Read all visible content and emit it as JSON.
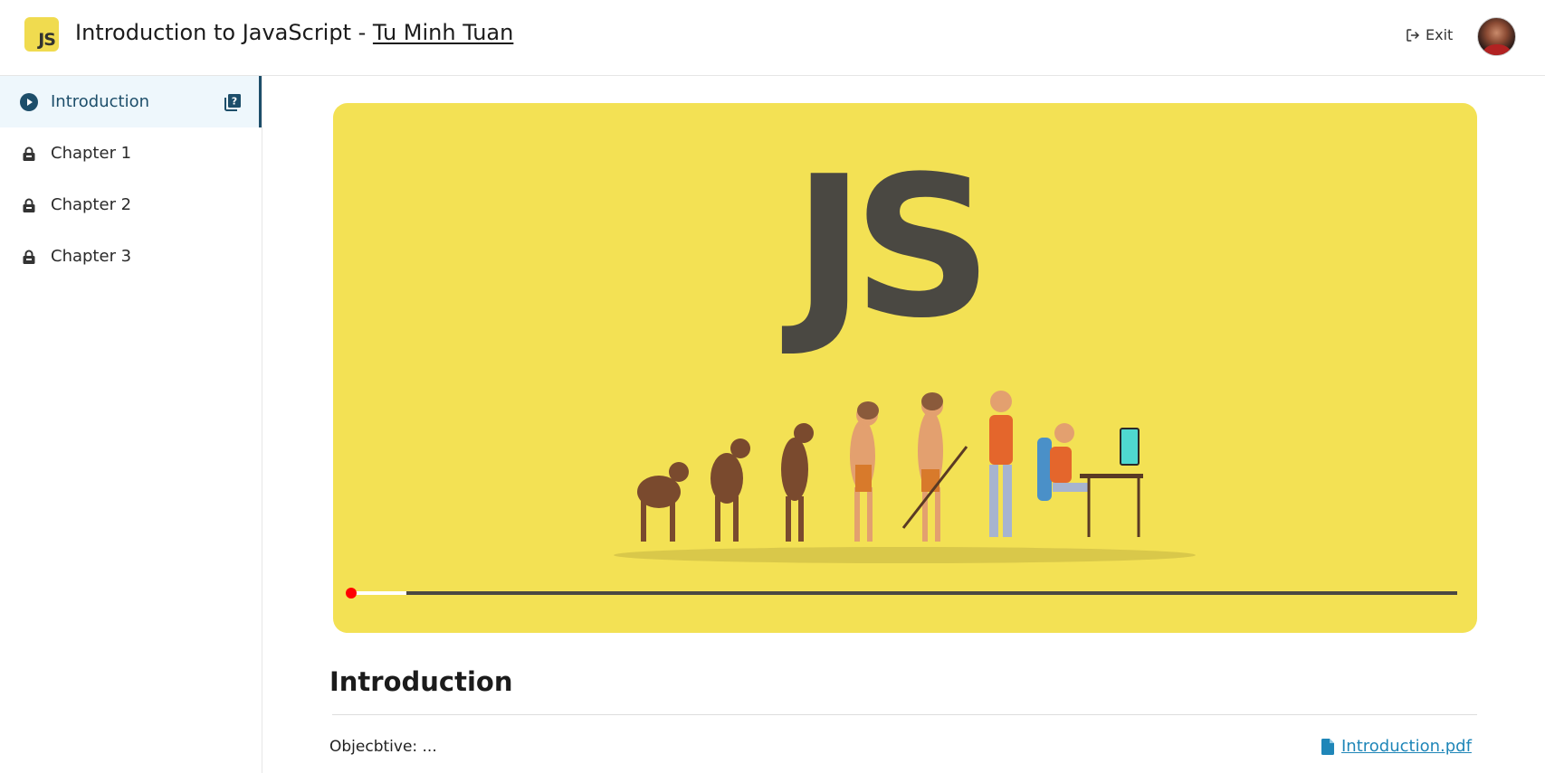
{
  "header": {
    "logo_text": "JS",
    "course_title": "Introduction to JavaScript - ",
    "author": "Tu Minh Tuan",
    "exit_label": "Exit"
  },
  "sidebar": {
    "items": [
      {
        "label": "Introduction",
        "icon": "play-circle-icon",
        "active": true,
        "locked": false
      },
      {
        "label": "Chapter 1",
        "icon": "lock-icon",
        "active": false,
        "locked": true
      },
      {
        "label": "Chapter 2",
        "icon": "lock-icon",
        "active": false,
        "locked": true
      },
      {
        "label": "Chapter 3",
        "icon": "lock-icon",
        "active": false,
        "locked": true
      }
    ],
    "quiz_icon": "quiz-book-icon"
  },
  "video": {
    "thumbnail_text": "JS",
    "progress": 0.05,
    "colors": {
      "background": "#f3e154",
      "track": "#4a4842",
      "played": "#ffffff",
      "knob": "#ff0000"
    }
  },
  "lesson": {
    "title": "Introduction",
    "objective": "Objecbtive: ...",
    "attachment": "Introduction.pdf"
  },
  "colors": {
    "accent": "#1d4e6a",
    "link": "#1f86b8",
    "active_bg": "#eef7fc"
  }
}
